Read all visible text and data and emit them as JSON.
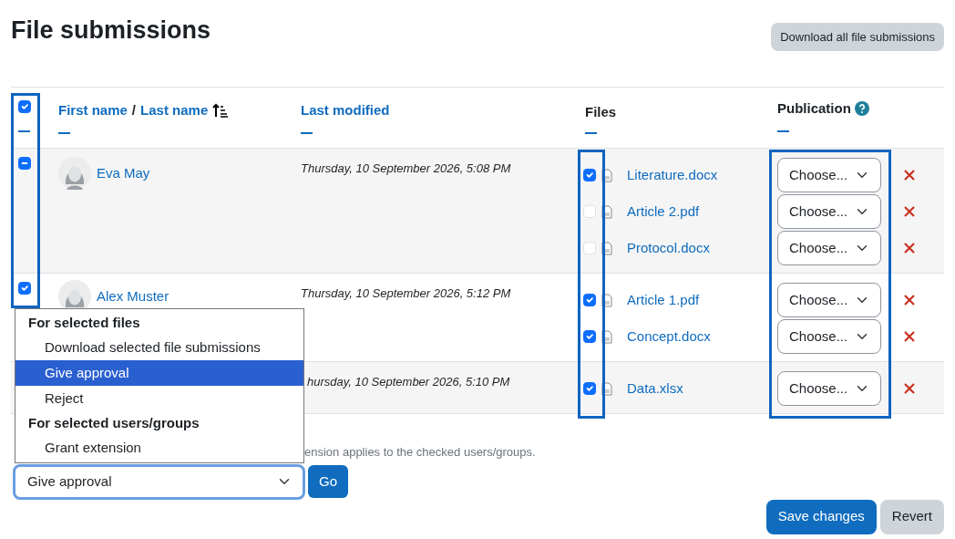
{
  "title": "File submissions",
  "download_all_button": "Download all file submissions",
  "header": {
    "checked": true,
    "first_name": "First name",
    "separator": "/",
    "last_name": "Last name",
    "last_modified": "Last modified",
    "files": "Files",
    "publication": "Publication"
  },
  "rows": [
    {
      "checked": true,
      "indeterminate": true,
      "name": "Eva May",
      "modified": "Thursday, 10 September 2026, 5:08 PM",
      "files": [
        {
          "name": "Literature.docx",
          "checked": true,
          "publication": "Choose..."
        },
        {
          "name": "Article 2.pdf",
          "checked": false,
          "publication": "Choose..."
        },
        {
          "name": "Protocol.docx",
          "checked": false,
          "publication": "Choose..."
        }
      ]
    },
    {
      "checked": true,
      "indeterminate": false,
      "name": "Alex Muster",
      "modified": "Thursday, 10 September 2026, 5:12 PM",
      "files": [
        {
          "name": "Article 1.pdf",
          "checked": true,
          "publication": "Choose..."
        },
        {
          "name": "Concept.docx",
          "checked": true,
          "publication": "Choose..."
        }
      ]
    },
    {
      "modified": "hursday, 10 September 2026, 5:10 PM",
      "files": [
        {
          "name": "Data.xlsx",
          "checked": true,
          "publication": "Choose..."
        }
      ]
    }
  ],
  "help_text": "ension applies to the checked users/groups.",
  "bulk_select": {
    "value": "Give approval"
  },
  "go_button": "Go",
  "bulk_menu": {
    "groups": [
      {
        "label": "For selected files",
        "options": [
          {
            "label": "Download selected file submissions",
            "selected": false
          },
          {
            "label": "Give approval",
            "selected": true
          },
          {
            "label": "Reject",
            "selected": false
          }
        ]
      },
      {
        "label": "For selected users/groups",
        "options": [
          {
            "label": "Grant extension",
            "selected": false
          }
        ]
      }
    ]
  },
  "save_button": "Save changes",
  "revert_button": "Revert"
}
